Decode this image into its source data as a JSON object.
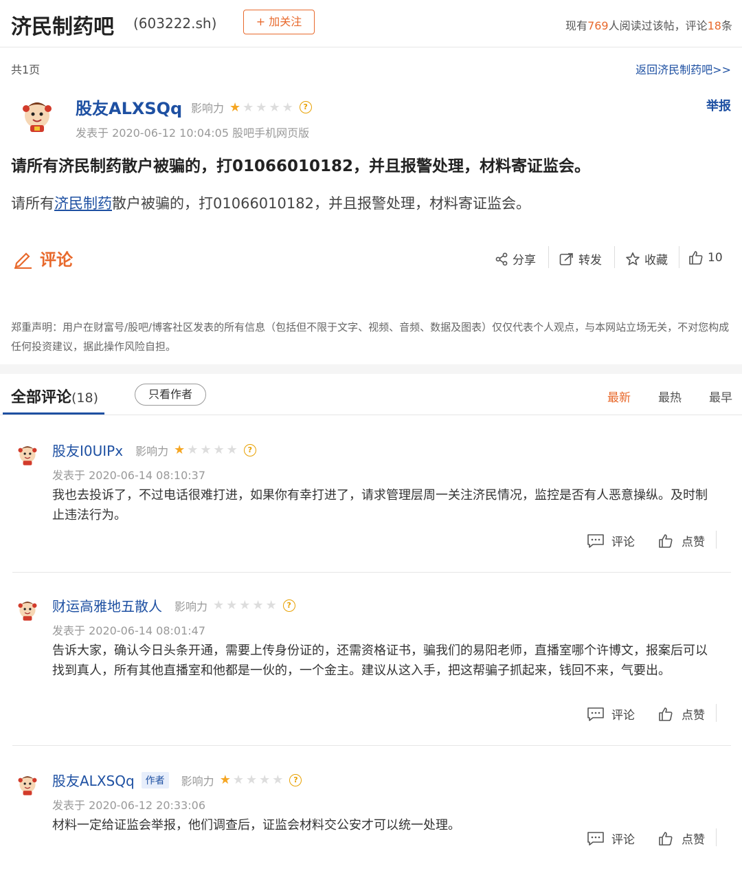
{
  "header": {
    "bar_name": "济民制药吧",
    "stock_code": "(603222.sh)",
    "follow_label": "+ 加关注",
    "stats_prefix": "现有",
    "readers": "769",
    "stats_mid": "人阅读过该帖，评论",
    "comment_count": "18",
    "stats_suffix": "条"
  },
  "pagination": {
    "pages_label": "共1页",
    "back_link": "返回济民制药吧>>"
  },
  "post": {
    "author": "股友ALXSQq",
    "influence_label": "影响力",
    "stars": 1,
    "meta": "发表于 2020-06-12 10:04:05 股吧手机网页版",
    "report_label": "举报",
    "title": "请所有济民制药散户被骗的，打01066010182，并且报警处理，材料寄证监会。",
    "body_prefix": "请所有",
    "body_link": "济民制药",
    "body_suffix": "散户被骗的，打01066010182，并且报警处理，材料寄证监会。",
    "comment_label": "评论",
    "share_label": "分享",
    "forward_label": "转发",
    "collect_label": "收藏",
    "like_count": "10",
    "disclaimer": "郑重声明：用户在财富号/股吧/博客社区发表的所有信息（包括但不限于文字、视频、音频、数据及图表）仅仅代表个人观点，与本网站立场无关，不对您构成任何投资建议，据此操作风险自担。"
  },
  "comments_header": {
    "tab_label": "全部评论",
    "tab_count": "(18)",
    "author_only_label": "只看作者",
    "sort_newest": "最新",
    "sort_hottest": "最热",
    "sort_earliest": "最早"
  },
  "comments": [
    {
      "author": "股友I0UIPx",
      "is_author": false,
      "influence_label": "影响力",
      "stars": 1,
      "time": "发表于 2020-06-14 08:10:37",
      "text": "我也去投诉了，不过电话很难打进，如果你有幸打进了，请求管理层周一关注济民情况，监控是否有人恶意操纵。及时制止违法行为。",
      "reply_label": "评论",
      "like_label": "点赞"
    },
    {
      "author": "财运高雅地五散人",
      "is_author": false,
      "influence_label": "影响力",
      "stars": 0,
      "time": "发表于 2020-06-14 08:01:47",
      "text": "告诉大家，确认今日头条开通，需要上传身份证的，还需资格证书，骗我们的易阳老师，直播室哪个许博文，报案后可以找到真人，所有其他直播室和他都是一伙的，一个金主。建议从这入手，把这帮骗子抓起来，钱回不来，气要出。",
      "reply_label": "评论",
      "like_label": "点赞"
    },
    {
      "author": "股友ALXSQq",
      "is_author": true,
      "author_badge": "作者",
      "influence_label": "影响力",
      "stars": 1,
      "time": "发表于 2020-06-12 20:33:06",
      "text": "材料一定给证监会举报，他们调查后，证监会材料交公安才可以统一处理。",
      "reply_label": "评论",
      "like_label": "点赞"
    }
  ],
  "colors": {
    "accent": "#e8692c",
    "link": "#1e50a2",
    "star": "#f5a623"
  }
}
